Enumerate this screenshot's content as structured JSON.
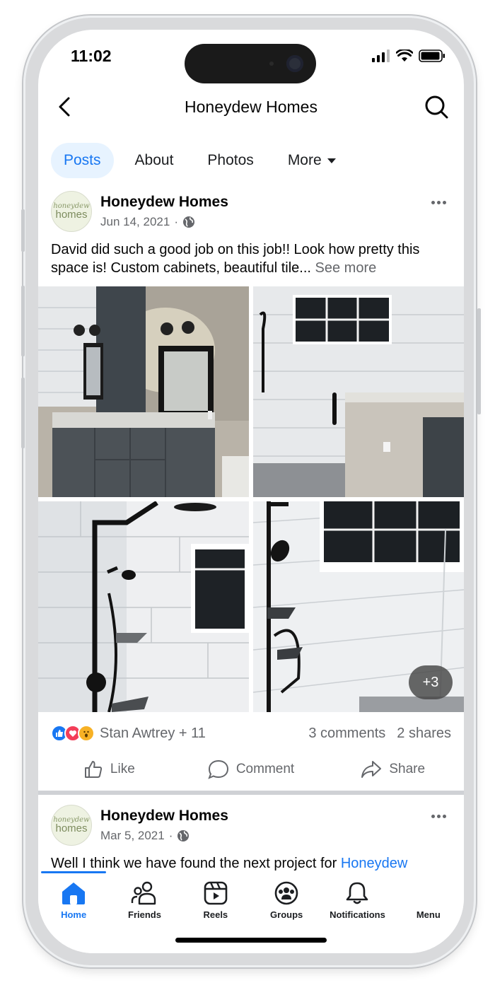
{
  "status_bar": {
    "time": "11:02"
  },
  "header": {
    "title": "Honeydew Homes"
  },
  "tabs": [
    {
      "label": "Posts",
      "active": true
    },
    {
      "label": "About",
      "active": false
    },
    {
      "label": "Photos",
      "active": false
    },
    {
      "label": "More",
      "active": false
    }
  ],
  "post1": {
    "author": "Honeydew Homes",
    "avatar_script": "honeydew",
    "avatar_word": "homes",
    "date": "Jun 14, 2021",
    "audience_sep": "·",
    "text": "David did such a good job on this job!! Look how pretty this space is! Custom cabinets, beautiful tile...",
    "see_more": "See more",
    "photo_more_count": "+3",
    "reactors": "Stan Awtrey + 11",
    "comments": "3 comments",
    "shares": "2 shares"
  },
  "actions": {
    "like": "Like",
    "comment": "Comment",
    "share": "Share"
  },
  "post2": {
    "author": "Honeydew Homes",
    "avatar_script": "honeydew",
    "avatar_word": "homes",
    "date": "Mar 5, 2021",
    "audience_sep": "·",
    "text": "Well I think we have found the next project for ",
    "link": "Honeydew"
  },
  "bottom_nav": [
    {
      "label": "Home",
      "icon": "home-icon",
      "active": true
    },
    {
      "label": "Friends",
      "icon": "friends-icon",
      "active": false
    },
    {
      "label": "Reels",
      "icon": "reels-icon",
      "active": false
    },
    {
      "label": "Groups",
      "icon": "groups-icon",
      "active": false
    },
    {
      "label": "Notifications",
      "icon": "bell-icon",
      "active": false
    },
    {
      "label": "Menu",
      "icon": "menu-icon",
      "active": false
    }
  ],
  "colors": {
    "accent": "#1877f2",
    "secondary_text": "#65676b",
    "tab_active_bg": "#e7f3ff"
  }
}
